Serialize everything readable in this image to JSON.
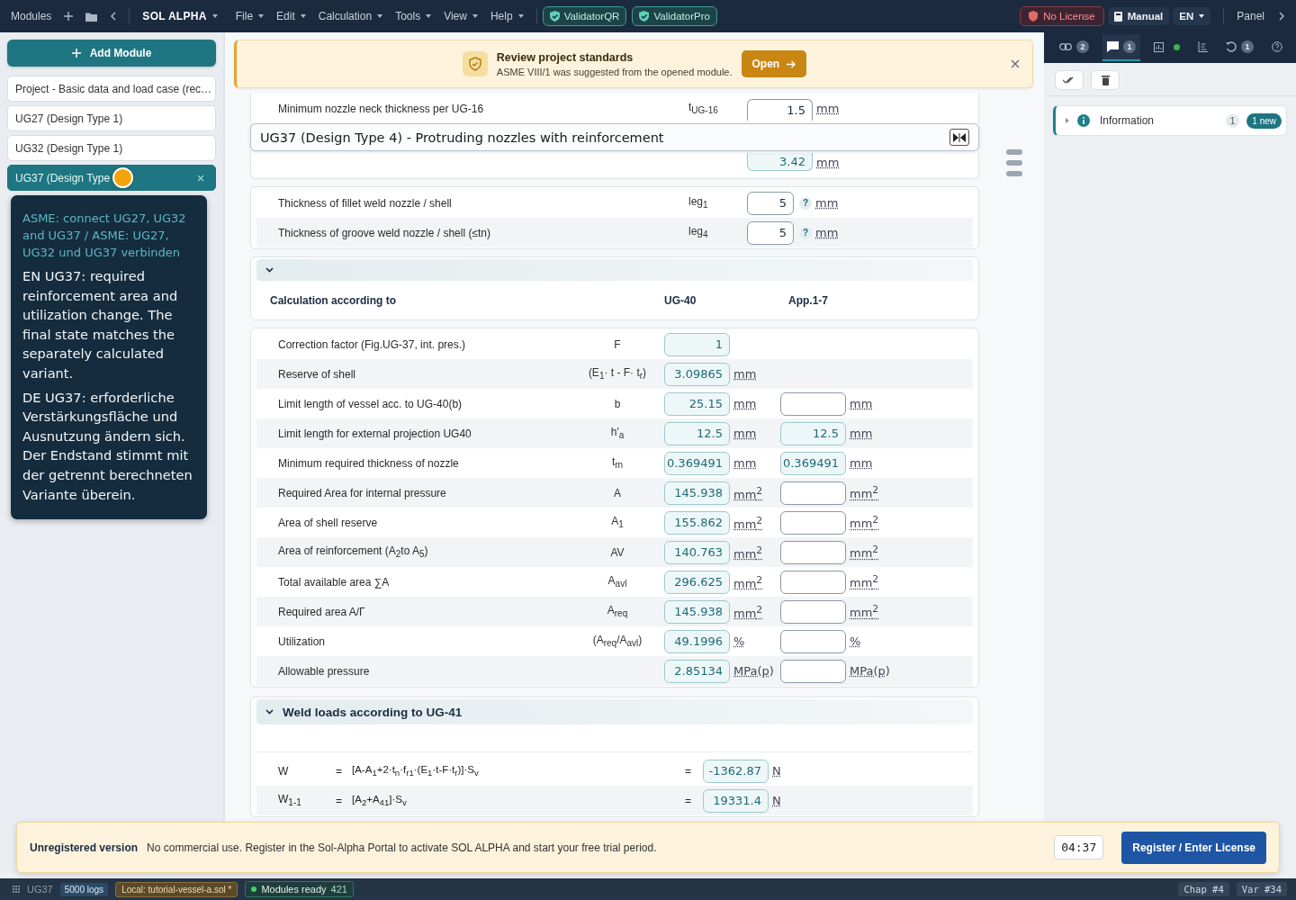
{
  "topbar": {
    "modules_label": "Modules",
    "app_name": "SOL ALPHA",
    "menus": [
      "File",
      "Edit",
      "Calculation",
      "Tools",
      "View",
      "Help"
    ],
    "validators": [
      "ValidatorQR",
      "ValidatorPro"
    ],
    "license_status": "No License",
    "manual_button": "Manual",
    "language": "EN",
    "panel_button": "Panel"
  },
  "sidebar": {
    "add_button": "Add Module",
    "items": [
      {
        "label": "Project - Basic data and load case (rec…",
        "selected": false
      },
      {
        "label": "UG27 (Design Type 1)",
        "selected": false
      },
      {
        "label": "UG32 (Design Type 1)",
        "selected": false
      },
      {
        "label": "UG37 (Design Type",
        "selected": true
      }
    ],
    "tooltip": {
      "title": "ASME: connect UG27, UG32 and UG37 / ASME: UG27, UG32 und UG37 verbinden",
      "paragraphs": [
        "EN UG37: required reinforcement area and utilization change. The final state matches the separately calculated variant.",
        "DE UG37: erforderliche Verstärkungsfläche und Ausnutzung ändern sich. Der Endstand stimmt mit der getrennt berechneten Variante überein."
      ]
    }
  },
  "banner": {
    "title": "Review project standards",
    "text": "ASME VIII/1 was suggested from the opened module.",
    "button": "Open"
  },
  "module_title": "UG37 (Design Type 4) - Protruding nozzles with reinforcement",
  "nozzle_rows": [
    {
      "label": "Minimum nozzle neck thickness per UG-16",
      "symbol": "t$_{UG-16}$",
      "value": "1.5",
      "unit": "mm",
      "computed": false
    },
    {
      "value": "3.42",
      "unit": "mm",
      "computed": true
    }
  ],
  "weld_inputs": [
    {
      "label": "Thickness of fillet weld nozzle / shell",
      "symbol": "leg$_{1}$",
      "value": "5",
      "help": "?",
      "unit": "mm"
    },
    {
      "label": "Thickness of groove weld nozzle / shell (≤tn)",
      "symbol": "leg$_{4}$",
      "value": "5",
      "help": "?",
      "unit": "mm"
    }
  ],
  "calc": {
    "columns": [
      "Calculation according to",
      "UG-40",
      "App.1-7"
    ],
    "rows": [
      {
        "label": "Correction factor (Fig.UG-37, int. pres.)",
        "symbol": "F",
        "ug40": {
          "value": "1",
          "computed": true
        }
      },
      {
        "label": "Reserve of shell",
        "symbol": "(E$_{1}$· t - F· t$_{r}$)",
        "ug40": {
          "value": "3.09865",
          "unit": "mm",
          "computed": true
        }
      },
      {
        "label": "Limit length of vessel acc. to UG-40(b)",
        "symbol": "b",
        "ug40": {
          "value": "25.15",
          "unit": "mm",
          "computed": true
        },
        "app": {
          "unit": "mm",
          "computed": false
        }
      },
      {
        "label": "Limit length for external projection UG40",
        "symbol": "h'$_{a}$",
        "ug40": {
          "value": "12.5",
          "unit": "mm",
          "computed": true
        },
        "app": {
          "value": "12.5",
          "unit": "mm",
          "computed": true
        }
      },
      {
        "label": "Minimum required thickness of nozzle",
        "symbol": "t$_{rn}$",
        "ug40": {
          "value": "0.369491",
          "unit": "mm",
          "computed": true
        },
        "app": {
          "value": "0.369491",
          "unit": "mm",
          "computed": true
        }
      },
      {
        "label": "Required Area for internal pressure",
        "symbol": "A",
        "ug40": {
          "value": "145.938",
          "unit": "mm$^{2}$",
          "computed": true
        },
        "app": {
          "unit": "mm$^{2}$",
          "computed": false
        }
      },
      {
        "label": "Area of shell reserve",
        "symbol": "A$_{1}$",
        "ug40": {
          "value": "155.862",
          "unit": "mm$^{2}$",
          "computed": true
        },
        "app": {
          "unit": "mm$^{2}$",
          "computed": false
        }
      },
      {
        "label": "Area of reinforcement (A$_{2}$to A$_{5}$)",
        "symbol": "AV",
        "ug40": {
          "value": "140.763",
          "unit": "mm$^{2}$",
          "computed": true
        },
        "app": {
          "unit": "mm$^{2}$",
          "computed": false
        }
      },
      {
        "label": "Total available area ∑A",
        "symbol": "A$_{avl}$",
        "ug40": {
          "value": "296.625",
          "unit": "mm$^{2}$",
          "computed": true
        },
        "app": {
          "unit": "mm$^{2}$",
          "computed": false
        }
      },
      {
        "label": "Required area A/Γ",
        "symbol": "A$_{req}$",
        "ug40": {
          "value": "145.938",
          "unit": "mm$^{2}$",
          "computed": true
        },
        "app": {
          "unit": "mm$^{2}$",
          "computed": false
        }
      },
      {
        "label": "Utilization",
        "symbol": "(A$_{req}$/A$_{avl}$)",
        "ug40": {
          "value": "49.1996",
          "unit": "%",
          "computed": true
        },
        "app": {
          "unit": "%",
          "computed": false
        }
      },
      {
        "label": "Allowable pressure",
        "ug40": {
          "value": "2.85134",
          "unit": "MPa(p)",
          "computed": true
        },
        "app": {
          "unit": "MPa(p)",
          "computed": false
        }
      }
    ]
  },
  "weld": {
    "title": "Weld loads according to UG-41",
    "rows": [
      {
        "name": "W",
        "eq": "=",
        "formula": "[A-A$_{1}$+2·t$_{n}$·f$_{r1}$·(E$_{1}$·t-F·t$_{r}$)]·S$_{v}$",
        "eq2": "=",
        "value": "-1362.87",
        "unit": "N"
      },
      {
        "name": "W$_{1-1}$",
        "eq": "=",
        "formula": "[A$_{2}$+A$_{41}$]·S$_{v}$",
        "eq2": "=",
        "value": "19331.4",
        "unit": "N"
      }
    ]
  },
  "license": {
    "label": "Unregistered version",
    "text": "No commercial use. Register in the Sol-Alpha Portal to activate SOL ALPHA and start your free trial period.",
    "timer": "04:37",
    "button": "Register / Enter License"
  },
  "status": {
    "module": "UG37",
    "logs": "5000 logs",
    "file": "Local: tutorial-vessel-a.sol *",
    "ready": "Modules ready",
    "ready_count": "421",
    "chapter": "Chap #4",
    "variant": "Var #34"
  },
  "panel": {
    "tabs": [
      {
        "kind": "link",
        "badge": "2",
        "selected": false
      },
      {
        "kind": "comment",
        "badge": "1",
        "selected": true
      },
      {
        "kind": "chart",
        "selected": false
      },
      {
        "kind": "list",
        "selected": false
      },
      {
        "kind": "history",
        "badge": "1",
        "selected": false
      },
      {
        "kind": "help",
        "selected": false
      }
    ],
    "messages": [
      {
        "label": "Information",
        "count": "1",
        "badge": "1 new",
        "expanded": false
      }
    ]
  }
}
